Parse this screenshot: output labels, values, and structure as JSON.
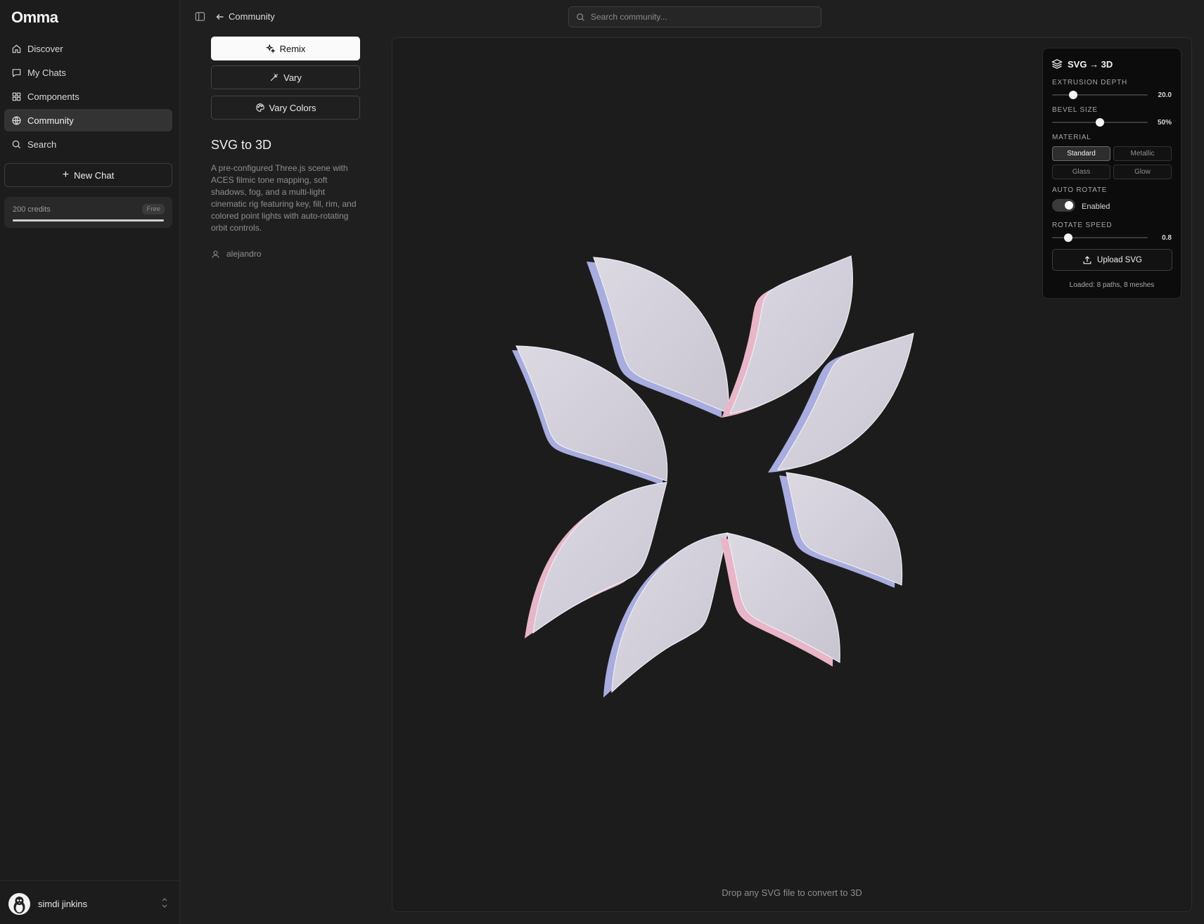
{
  "app": {
    "name": "Omma"
  },
  "sidebar": {
    "items": [
      {
        "label": "Discover",
        "icon": "home-icon"
      },
      {
        "label": "My Chats",
        "icon": "chat-icon"
      },
      {
        "label": "Components",
        "icon": "grid-icon"
      },
      {
        "label": "Community",
        "icon": "globe-icon",
        "active": true
      },
      {
        "label": "Search",
        "icon": "search-icon"
      }
    ],
    "new_chat_label": "New Chat",
    "credits": {
      "text": "200 credits",
      "plan": "Free",
      "fraction": 1.0
    },
    "user": {
      "name": "simdi jinkins"
    }
  },
  "header": {
    "back_label": "Community",
    "search_placeholder": "Search community..."
  },
  "actions": {
    "remix_label": "Remix",
    "vary_label": "Vary",
    "vary_colors_label": "Vary Colors"
  },
  "project": {
    "title": "SVG to 3D",
    "description": "A pre-configured Three.js scene with ACES filmic tone mapping, soft shadows, fog, and a multi-light cinematic rig featuring key, fill, rim, and colored point lights with auto-rotating orbit controls.",
    "author": "alejandro"
  },
  "viewer": {
    "drop_hint": "Drop any SVG file to convert to 3D"
  },
  "panel": {
    "title": "SVG → 3D",
    "extrusion_label": "EXTRUSION DEPTH",
    "extrusion_value": "20.0",
    "extrusion_fraction": 0.22,
    "bevel_label": "BEVEL SIZE",
    "bevel_value": "50%",
    "bevel_fraction": 0.5,
    "material_label": "MATERIAL",
    "materials": [
      "Standard",
      "Metallic",
      "Glass",
      "Glow"
    ],
    "selected_material": "Standard",
    "auto_rotate_label": "AUTO ROTATE",
    "auto_rotate_state": "Enabled",
    "rotate_speed_label": "ROTATE SPEED",
    "rotate_speed_value": "0.8",
    "rotate_speed_fraction": 0.17,
    "upload_label": "Upload SVG",
    "loaded_text": "Loaded: 8 paths, 8 meshes"
  },
  "colors": {
    "accent": "#fafafa",
    "petal": "#d3d0dc",
    "petal_edge": "#a9acde",
    "petal_rim": "#e8b6c8"
  }
}
